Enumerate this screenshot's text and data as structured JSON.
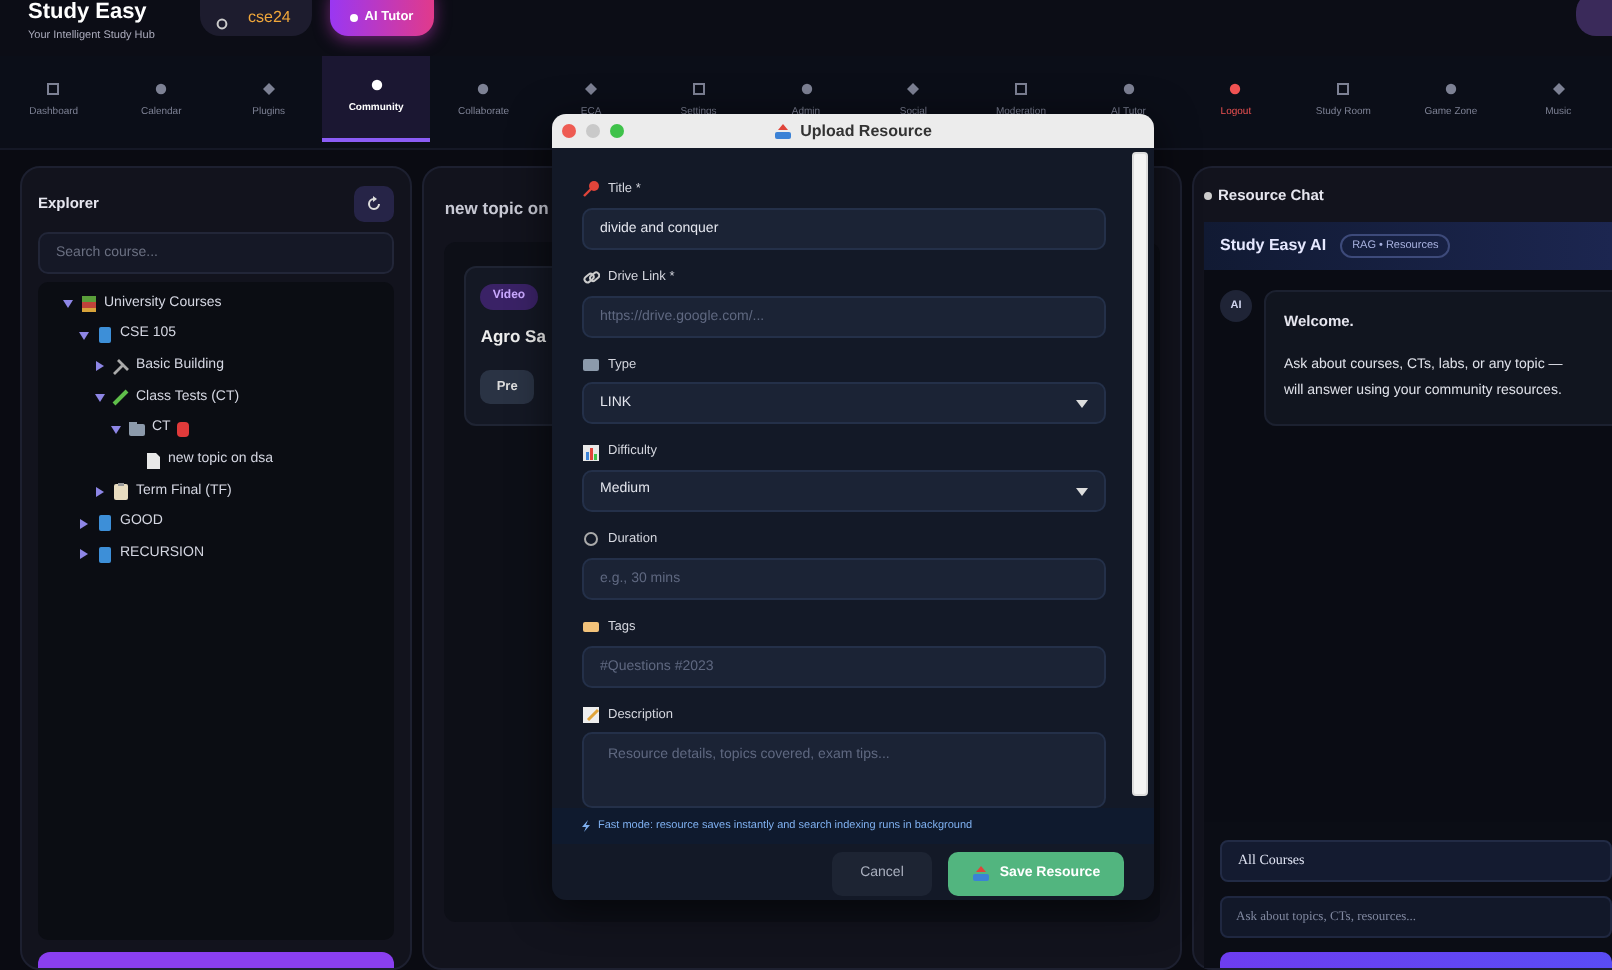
{
  "header": {
    "title": "Study Easy",
    "subtitle": "Your Intelligent Study Hub",
    "user_pill": "cse24",
    "ai_button": "AI Tutor"
  },
  "nav": [
    {
      "label": "Dashboard",
      "selected": false,
      "kind": "normal"
    },
    {
      "label": "Calendar",
      "selected": false,
      "kind": "normal"
    },
    {
      "label": "Plugins",
      "selected": false,
      "kind": "normal"
    },
    {
      "label": "Community",
      "selected": true,
      "kind": "normal"
    },
    {
      "label": "Collaborate",
      "selected": false,
      "kind": "normal"
    },
    {
      "label": "ECA",
      "selected": false,
      "kind": "normal"
    },
    {
      "label": "Settings",
      "selected": false,
      "kind": "normal"
    },
    {
      "label": "Admin",
      "selected": false,
      "kind": "normal"
    },
    {
      "label": "Social",
      "selected": false,
      "kind": "normal"
    },
    {
      "label": "Moderation",
      "selected": false,
      "kind": "normal"
    },
    {
      "label": "AI Tutor",
      "selected": false,
      "kind": "normal"
    },
    {
      "label": "Logout",
      "selected": false,
      "kind": "danger"
    },
    {
      "label": "Study Room",
      "selected": false,
      "kind": "normal"
    },
    {
      "label": "Game Zone",
      "selected": false,
      "kind": "normal"
    },
    {
      "label": "Music",
      "selected": false,
      "kind": "normal"
    }
  ],
  "explorer": {
    "title": "Explorer",
    "search_placeholder": "Search course...",
    "tree": [
      {
        "label": "University Courses",
        "kind": "category",
        "expanded": true,
        "children": [
          {
            "label": "CSE 105",
            "kind": "course",
            "expanded": true,
            "children": [
              {
                "label": "Basic Building",
                "kind": "tools",
                "expanded": false
              },
              {
                "label": "Class Tests (CT)",
                "kind": "pencil",
                "expanded": true,
                "children": [
                  {
                    "label": "CT",
                    "kind": "folder",
                    "expanded": true,
                    "flagged": true,
                    "children": [
                      {
                        "label": "new topic on dsa",
                        "kind": "file"
                      }
                    ]
                  }
                ]
              },
              {
                "label": "Term Final (TF)",
                "kind": "clipboard",
                "expanded": false
              }
            ]
          },
          {
            "label": "GOOD",
            "kind": "course",
            "expanded": false
          },
          {
            "label": "RECURSION",
            "kind": "course",
            "expanded": false
          }
        ]
      }
    ]
  },
  "content": {
    "title": "new topic on",
    "card": {
      "badge": "Video",
      "title": "Agro Sa",
      "button": "Pre"
    }
  },
  "modal": {
    "title": "Upload Resource",
    "fields": [
      {
        "label": "Title *",
        "kind": "input",
        "value": "divide and conquer"
      },
      {
        "label": "Drive Link *",
        "kind": "input",
        "placeholder": "https://drive.google.com/..."
      },
      {
        "label": "Type",
        "kind": "select",
        "value": "LINK"
      },
      {
        "label": "Difficulty",
        "kind": "select",
        "value": "Medium"
      },
      {
        "label": "Duration",
        "kind": "input",
        "placeholder": "e.g., 30 mins"
      },
      {
        "label": "Tags",
        "kind": "input",
        "placeholder": "#Questions #2023"
      },
      {
        "label": "Description",
        "kind": "textarea",
        "placeholder": "Resource details, topics covered, exam tips..."
      }
    ],
    "note": "Fast mode: resource saves instantly and search indexing runs in background",
    "cancel": "Cancel",
    "save": "Save Resource"
  },
  "chat": {
    "title": "Resource Chat",
    "bot_name": "Study Easy AI",
    "bot_badge": "RAG • Resources",
    "avatar": "AI",
    "welcome": "Welcome.",
    "message": "Ask about courses, CTs, labs, or any topic —\nwill answer using your community resources.",
    "scope": "All Courses",
    "input_placeholder": "Ask about topics, CTs, resources..."
  }
}
